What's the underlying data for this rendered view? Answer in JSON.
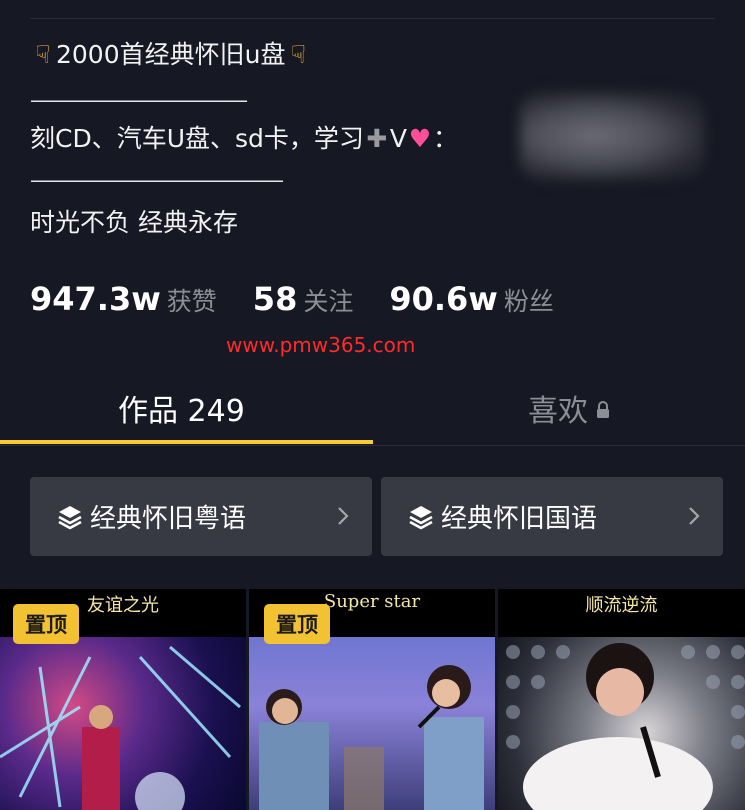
{
  "profile": {
    "bio": {
      "line1": "2000首经典怀旧u盘",
      "divider_a": "————————————",
      "line3": "刻CD、汽车U盘、sd卡，学习",
      "line3_tail": "V",
      "line3_end": "：",
      "divider_b": "——————————————",
      "line5": "时光不负 经典永存"
    },
    "stats": [
      {
        "value": "947.3w",
        "label": "获赞"
      },
      {
        "value": "58",
        "label": "关注"
      },
      {
        "value": "90.6w",
        "label": "粉丝"
      }
    ],
    "watermark": "www.pmw365.com"
  },
  "tabs": {
    "works": "作品 249",
    "likes": "喜欢"
  },
  "collections": [
    {
      "label": "经典怀旧粤语"
    },
    {
      "label": "经典怀旧国语"
    }
  ],
  "videos": [
    {
      "title": "友谊之光",
      "badge": "置顶"
    },
    {
      "title": "Super star",
      "badge": "置顶"
    },
    {
      "title": "顺流逆流"
    }
  ],
  "colors": {
    "background": "#161823",
    "accent_underline": "#facb35",
    "pin_badge": "#f3c232",
    "muted_text": "#8d8e95",
    "watermark": "#ff2a2a"
  },
  "icons": [
    "pointing-down-hand-icon",
    "plus-icon",
    "heart-icon",
    "lock-icon",
    "layers-icon",
    "chevron-right-icon"
  ]
}
